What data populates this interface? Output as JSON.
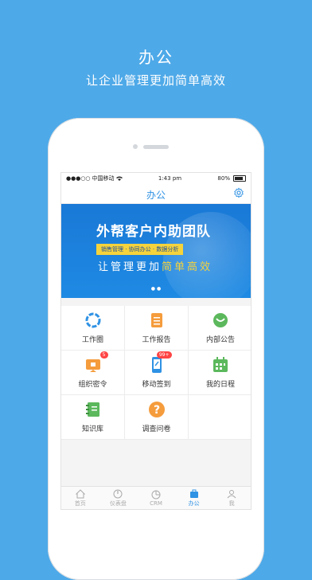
{
  "promo": {
    "headline": "办公",
    "subline": "让企业管理更加简单高效"
  },
  "status_bar": {
    "signal": "●●●○○",
    "carrier": "中国移动",
    "wifi_icon": "wifi-icon",
    "time": "1:43 pm",
    "battery": "80%"
  },
  "nav": {
    "title": "办公",
    "settings_icon": "gear-icon"
  },
  "banner": {
    "title": "外帮客户内助团队",
    "tagline": "销售管理 · 协同办公 · 数据分析",
    "sub_prefix": "让管理更加",
    "sub_highlight": "简单高效",
    "page_dots": "● ●"
  },
  "grid": [
    {
      "label": "工作圈",
      "icon": "work-circle-icon",
      "color": "#2f92e4"
    },
    {
      "label": "工作报告",
      "icon": "report-icon",
      "color": "#f59c3c"
    },
    {
      "label": "内部公告",
      "icon": "announcement-icon",
      "color": "#5cb85c"
    },
    {
      "label": "组织密令",
      "icon": "secret-order-icon",
      "color": "#f59c3c",
      "badge": "5"
    },
    {
      "label": "移动签到",
      "icon": "mobile-checkin-icon",
      "color": "#2f92e4",
      "badge": "99+"
    },
    {
      "label": "我的日程",
      "icon": "calendar-icon",
      "color": "#5cb85c"
    },
    {
      "label": "知识库",
      "icon": "knowledge-base-icon",
      "color": "#5cb85c"
    },
    {
      "label": "调查问卷",
      "icon": "survey-icon",
      "color": "#f59c3c"
    }
  ],
  "tabbar": [
    {
      "label": "首页",
      "icon": "home-icon"
    },
    {
      "label": "仪表盘",
      "icon": "dashboard-icon"
    },
    {
      "label": "CRM",
      "icon": "crm-icon"
    },
    {
      "label": "办公",
      "icon": "briefcase-icon",
      "active": true
    },
    {
      "label": "我",
      "icon": "user-icon"
    }
  ],
  "colors": {
    "background": "#4ea9e8",
    "accent": "#2f92e4",
    "highlight": "#f5d33c"
  }
}
